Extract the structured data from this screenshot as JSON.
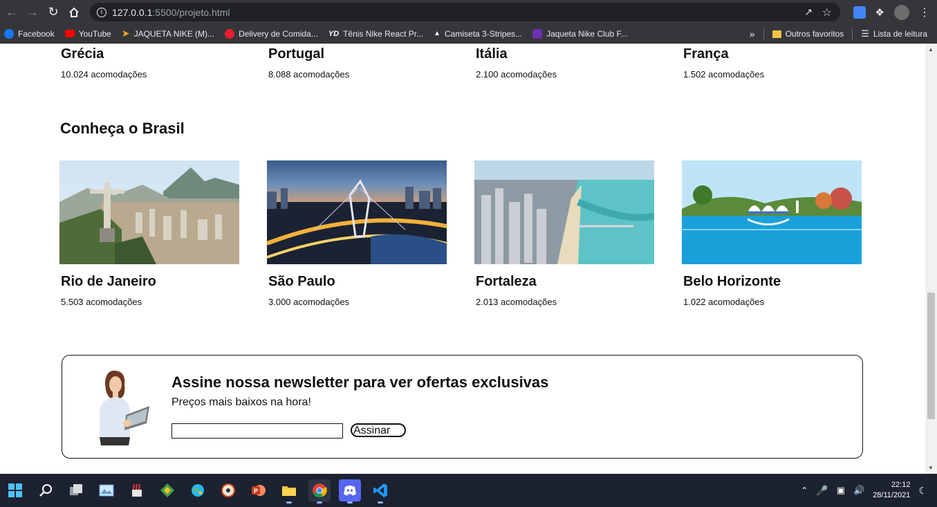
{
  "browser": {
    "url_host": "127.0.0.1",
    "url_rest": ":5500/projeto.html",
    "bookmarks": [
      {
        "label": "Facebook",
        "color": "#1877f2"
      },
      {
        "label": "YouTube",
        "color": "#ff0000"
      },
      {
        "label": "JAQUETA NIKE (M)...",
        "color": "#f5a623"
      },
      {
        "label": "Delivery de Comida...",
        "color": "#ea1d2c"
      },
      {
        "label": "Tênis Nike React Pr...",
        "color": "#ffffff"
      },
      {
        "label": "Camiseta 3-Stripes...",
        "color": "#000000"
      },
      {
        "label": "Jaqueta Nike Club F...",
        "color": "#6b2fb3"
      }
    ],
    "more": "»",
    "other_favorites": "Outros favoritos",
    "reading_list": "Lista de leitura"
  },
  "europe_row": [
    {
      "name": "Grécia",
      "count": "10.024 acomodações"
    },
    {
      "name": "Portugal",
      "count": "8.088 acomodações"
    },
    {
      "name": "Itália",
      "count": "2.100 acomodações"
    },
    {
      "name": "França",
      "count": "1.502 acomodações"
    }
  ],
  "brasil": {
    "title": "Conheça o Brasil",
    "cities": [
      {
        "name": "Rio de Janeiro",
        "count": "5.503 acomodações"
      },
      {
        "name": "São Paulo",
        "count": "3.000 acomodações"
      },
      {
        "name": "Fortaleza",
        "count": "2.013 acomodações"
      },
      {
        "name": "Belo Horizonte",
        "count": "1.022 acomodações"
      }
    ]
  },
  "newsletter": {
    "title": "Assine nossa newsletter para ver ofertas exclusivas",
    "subtitle": "Preços mais baixos na hora!",
    "input_value": "",
    "button": "Assinar"
  },
  "taskbar": {
    "time": "22:12",
    "date": "28/11/2021"
  }
}
